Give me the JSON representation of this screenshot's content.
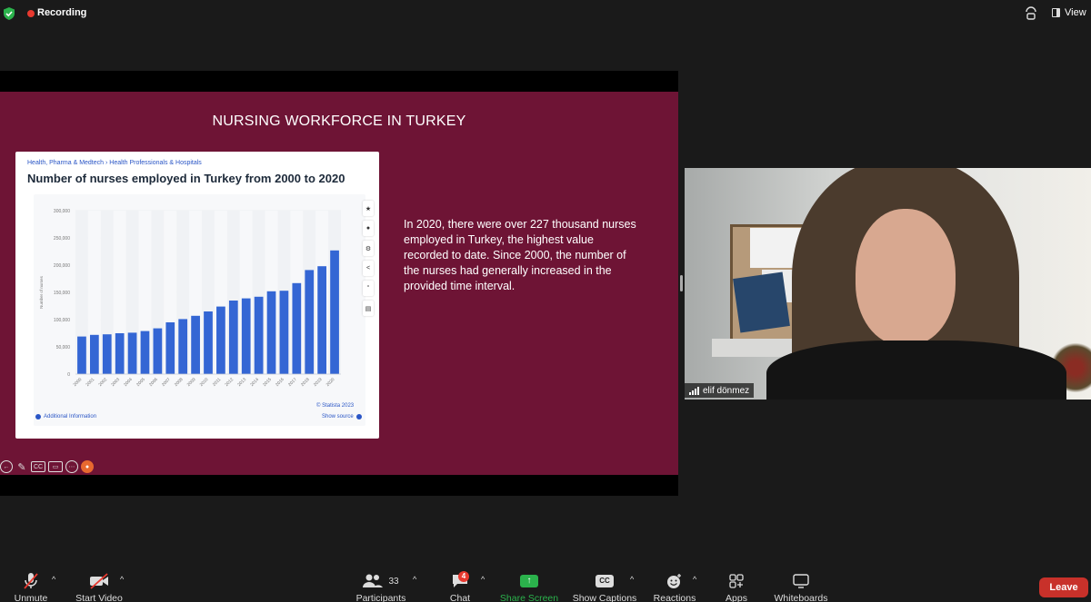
{
  "topbar": {
    "recording_label": "Recording",
    "view_label": "View"
  },
  "slide": {
    "title": "NURSING WORKFORCE IN TURKEY",
    "breadcrumbs": "Health, Pharma & Medtech  ›  Health Professionals & Hospitals",
    "card_title": "Number of nurses employed in Turkey from 2000 to 2020",
    "statista_credit": "© Statista 2023",
    "additional_info": "Additional Information",
    "show_source": "Show source",
    "body_text": "In 2020, there were over 227 thousand nurses employed in Turkey, the highest value recorded to date. Since 2000, the number of the nurses had generally increased in the provided time interval."
  },
  "chart_data": {
    "type": "bar",
    "ylabel": "Number of nurses",
    "ylim": [
      0,
      300000
    ],
    "yticks": [
      0,
      50000,
      100000,
      150000,
      200000,
      250000,
      300000
    ],
    "ytick_labels": [
      "0",
      "50,000",
      "100,000",
      "150,000",
      "200,000",
      "250,000",
      "300,000"
    ],
    "categories": [
      "2000",
      "2001",
      "2002",
      "2003",
      "2004",
      "2005",
      "2006",
      "2007",
      "2008",
      "2009",
      "2010",
      "2011",
      "2012",
      "2013",
      "2014",
      "2015",
      "2016",
      "2017",
      "2018",
      "2019",
      "2020"
    ],
    "values": [
      69000,
      72000,
      73000,
      75000,
      76000,
      79000,
      84000,
      95000,
      101000,
      107000,
      115000,
      124000,
      135000,
      139000,
      142000,
      152000,
      153000,
      167000,
      191000,
      198000,
      227000
    ],
    "bar_color": "#3466d4",
    "grid": true
  },
  "video": {
    "participant_name": "elif dönmez"
  },
  "toolbar": {
    "unmute": "Unmute",
    "start_video": "Start Video",
    "participants": "Participants",
    "participant_count": "33",
    "chat": "Chat",
    "chat_badge": "4",
    "share_screen": "Share Screen",
    "show_captions": "Show Captions",
    "captions_icon_text": "CC",
    "reactions": "Reactions",
    "apps": "Apps",
    "whiteboards": "Whiteboards",
    "leave": "Leave"
  },
  "colors": {
    "slide_bg": "#6e1435",
    "share_green": "#2bb24c",
    "leave_red": "#c8312a",
    "recording_red": "#e8392f"
  }
}
